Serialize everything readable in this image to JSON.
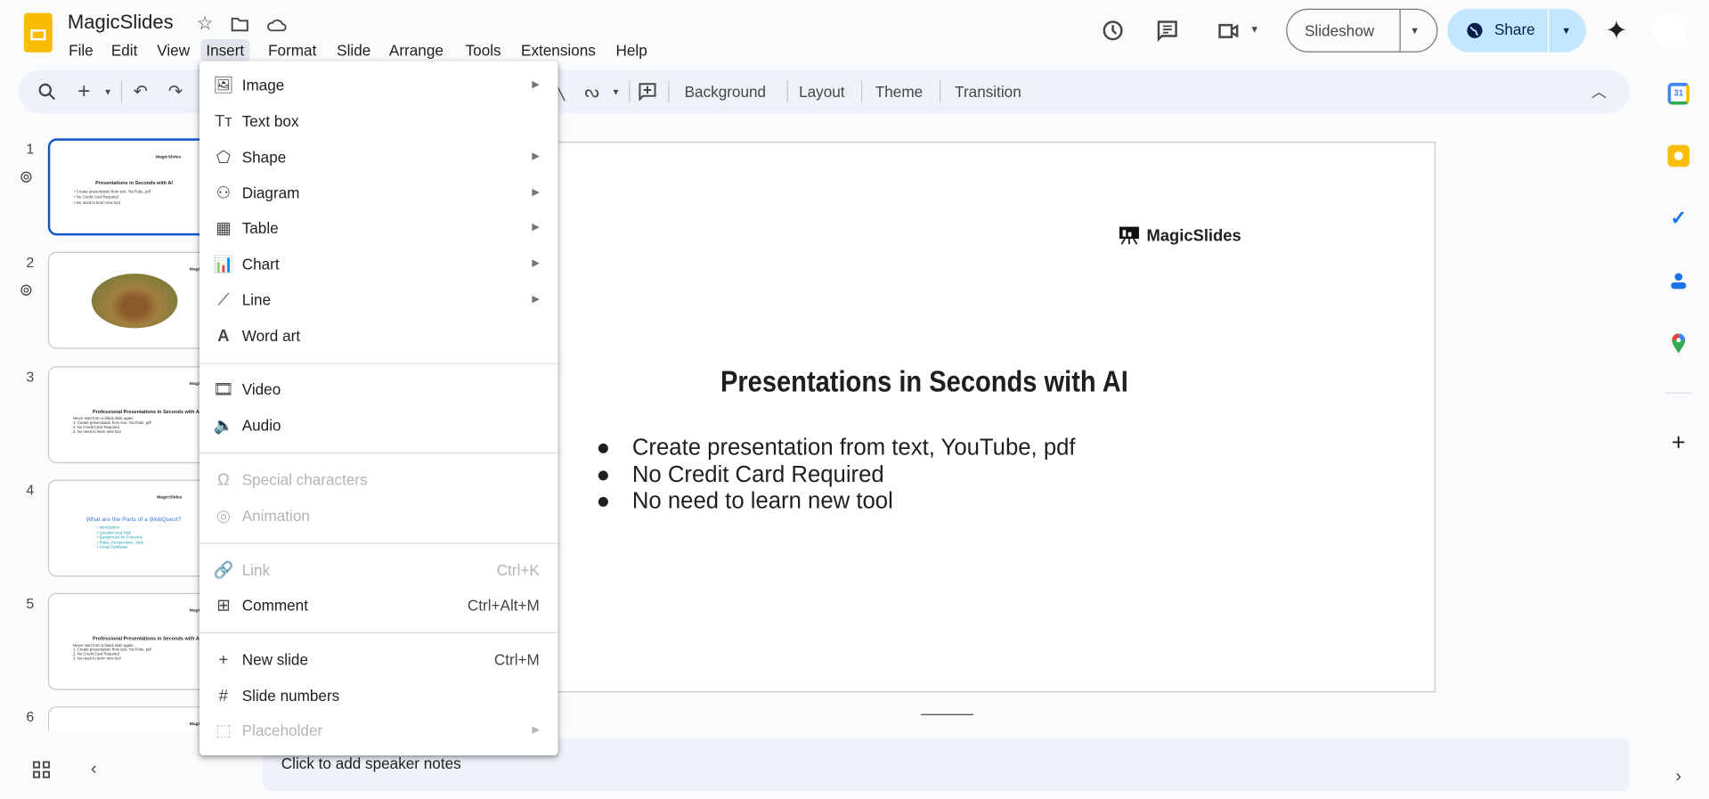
{
  "app": {
    "title": "MagicSlides"
  },
  "menubar": [
    "File",
    "Edit",
    "View",
    "Insert",
    "Format",
    "Slide",
    "Arrange",
    "Tools",
    "Extensions",
    "Help"
  ],
  "header": {
    "slideshow_label": "Slideshow",
    "share_label": "Share"
  },
  "toolbar": {
    "background": "Background",
    "layout": "Layout",
    "theme": "Theme",
    "transition": "Transition"
  },
  "insert_menu": {
    "items": [
      {
        "label": "Image",
        "icon": "image-icon",
        "submenu": true
      },
      {
        "label": "Text box",
        "icon": "text-box-icon"
      },
      {
        "label": "Shape",
        "icon": "shape-icon",
        "submenu": true
      },
      {
        "label": "Diagram",
        "icon": "diagram-icon",
        "submenu": true
      },
      {
        "label": "Table",
        "icon": "table-icon",
        "submenu": true
      },
      {
        "label": "Chart",
        "icon": "chart-icon",
        "submenu": true
      },
      {
        "label": "Line",
        "icon": "line-icon",
        "submenu": true
      },
      {
        "label": "Word art",
        "icon": "word-art-icon"
      },
      {
        "label": "Video",
        "icon": "video-icon"
      },
      {
        "label": "Audio",
        "icon": "audio-icon"
      },
      {
        "label": "Special characters",
        "icon": "omega-icon",
        "disabled": true
      },
      {
        "label": "Animation",
        "icon": "animation-icon",
        "disabled": true
      },
      {
        "label": "Link",
        "icon": "link-icon",
        "shortcut": "Ctrl+K",
        "disabled": true
      },
      {
        "label": "Comment",
        "icon": "add-comment-icon",
        "shortcut": "Ctrl+Alt+M"
      },
      {
        "label": "New slide",
        "icon": "plus-icon",
        "shortcut": "Ctrl+M"
      },
      {
        "label": "Slide numbers",
        "icon": "hash-icon"
      },
      {
        "label": "Placeholder",
        "icon": "placeholder-icon",
        "submenu": true,
        "disabled": true
      }
    ]
  },
  "filmstrip": [
    {
      "num": "1",
      "logo": "MagicSlides",
      "title": "Presentations in Seconds with AI",
      "lines": [
        "• Create presentation from text, YouTube, pdf",
        "• No Credit Card Required",
        "• No need to learn new tool"
      ]
    },
    {
      "num": "2",
      "logo": "MagicSlides"
    },
    {
      "num": "3",
      "logo": "MagicSlides",
      "title": "Professional Presentations in Seconds with AI",
      "lines": [
        "Never start from a blank slide again.",
        "1. Create presentation from text, YouTube, pdf",
        "2. No Credit Card Required",
        "3. No need to learn new tool"
      ]
    },
    {
      "num": "4",
      "logo": "MagicSlides",
      "title": "What are the Parts of a WebQuest?",
      "lines": [
        "• Introduction",
        "• Question and Task",
        "• Background for Everyone",
        "• Roles, Perspectives, Jobs",
        "• Group Synthesis"
      ]
    },
    {
      "num": "5",
      "logo": "MagicSlides",
      "title": "Professional Presentations in Seconds with AI",
      "lines": [
        "Never start from a blank slide again.",
        "1. Create presentation from text, YouTube, pdf",
        "2. No Credit Card Required",
        "3. No need to learn new tool"
      ]
    },
    {
      "num": "6",
      "logo": "MagicSlides"
    }
  ],
  "slide": {
    "logo": "MagicSlides",
    "title": "Presentations in Seconds with AI",
    "bullets": [
      "Create presentation from text, YouTube, pdf",
      "No Credit Card Required",
      "No need to learn new tool"
    ]
  },
  "notes": {
    "placeholder": "Click to add speaker notes"
  },
  "colors": {
    "accent": "#0b57d0",
    "share_bg": "#c2e7ff",
    "toolbar_bg": "#eef2f9"
  }
}
